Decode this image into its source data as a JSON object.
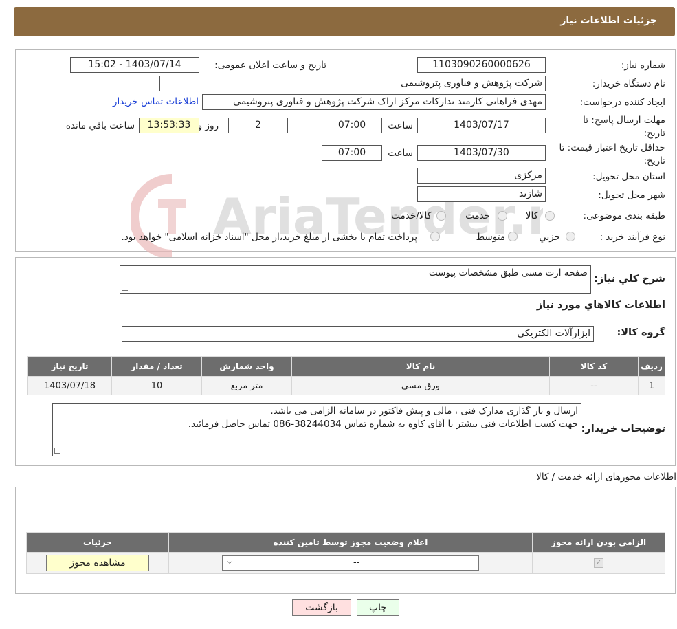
{
  "header": {
    "title": "جزئیات اطلاعات نیاز"
  },
  "form": {
    "need_number_label": "شماره نیاز:",
    "need_number": "1103090260000626",
    "announce_label": "تاریخ و ساعت اعلان عمومی:",
    "announce_value": "1403/07/14 - 15:02",
    "buyer_org_label": "نام دستگاه خریدار:",
    "buyer_org": "شرکت پژوهش و فناوری پتروشیمی",
    "requester_label": "ایجاد کننده درخواست:",
    "requester": "مهدی فراهانی کارمند تدارکات مرکز اراک شرکت پژوهش و فناوری پتروشیمی",
    "contact_link": "اطلاعات تماس خریدار",
    "deadline_label": "مهلت ارسال پاسخ: تا تاریخ:",
    "deadline_date": "1403/07/17",
    "time_label": "ساعت",
    "deadline_time": "07:00",
    "days_value": "2",
    "days_label": "روز و",
    "remaining_value": "13:53:33",
    "remaining_label": "ساعت باقي مانده",
    "validity_label": "حداقل تاریخ اعتبار قیمت: تا تاریخ:",
    "validity_date": "1403/07/30",
    "validity_time": "07:00",
    "province_label": "استان محل تحویل:",
    "province": "مرکزی",
    "city_label": "شهر محل تحویل:",
    "city": "شازند",
    "category_label": "طبقه بندی موضوعی:",
    "category_options": [
      "کالا",
      "خدمت",
      "کالا/خدمت"
    ],
    "process_label": "نوع فرآیند خرید :",
    "process_options": [
      "جزیي",
      "متوسط"
    ],
    "process_note": "پرداخت تمام یا بخشی از مبلغ خرید،از محل \"اسناد خزانه اسلامی\" خواهد بود."
  },
  "summary": {
    "desc_label": "شرح كلي نياز:",
    "desc_value": "صفحه ارت مسی طبق مشخصات پیوست",
    "goods_title": "اطلاعات كالاهاي مورد نياز",
    "group_label": "گروه كالا:",
    "group_value": "ابزارآلات الکتریکی",
    "table": {
      "headers": [
        "رديف",
        "كد كالا",
        "نام كالا",
        "واحد شمارش",
        "تعداد / مقدار",
        "تاریخ نیاز"
      ],
      "rows": [
        [
          "1",
          "--",
          "ورق مسی",
          "متر مربع",
          "10",
          "1403/07/18"
        ]
      ]
    },
    "buyer_notes_label": "توضیحات خریدار:",
    "buyer_notes": [
      "ارسال و بار گذاری مدارک فنی ، مالی و پیش فاکتور در سامانه الزامی می باشد.",
      "جهت کسب اطلاعات فنی بیشتر با آقای کاوه به شماره تماس 38244034-086 تماس حاصل فرمائید."
    ]
  },
  "licenses": {
    "title": "اطلاعات مجوزهای ارائه خدمت / کالا",
    "headers": [
      "الزامی بودن ارائه مجوز",
      "اعلام وضعیت مجوز توسط تامین کننده",
      "جزئیات"
    ],
    "select_value": "--",
    "view_button": "مشاهده مجوز"
  },
  "footer": {
    "print_button": "چاپ",
    "back_button": "بازگشت"
  },
  "watermark": {
    "text": "AriaTender.neT"
  },
  "colors": {
    "header_bg": "#8c6a3f",
    "table_header_bg": "#6d6d6d",
    "link": "#1a3fd6",
    "back_button_bg": "#ffe0e0",
    "print_button_bg": "#eaffea"
  }
}
